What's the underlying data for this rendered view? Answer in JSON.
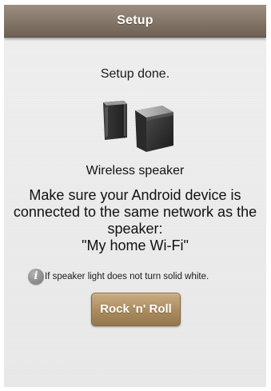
{
  "header": {
    "title": "Setup"
  },
  "status": {
    "message": "Setup done."
  },
  "device": {
    "icon": "speaker-icon",
    "name": "Wireless speaker"
  },
  "instruction": {
    "line1": "Make sure your Android device is",
    "line2": "connected to the same network as the",
    "line3": "speaker:",
    "network_name": "\"My home Wi-Fi\""
  },
  "hint": {
    "icon": "info-icon",
    "icon_glyph": "i",
    "text": "If speaker light does not turn solid white."
  },
  "actions": {
    "primary_label": "Rock 'n' Roll"
  },
  "colors": {
    "title_bar": "#877a6c",
    "button": "#ad8e62",
    "background": "#ececec"
  }
}
